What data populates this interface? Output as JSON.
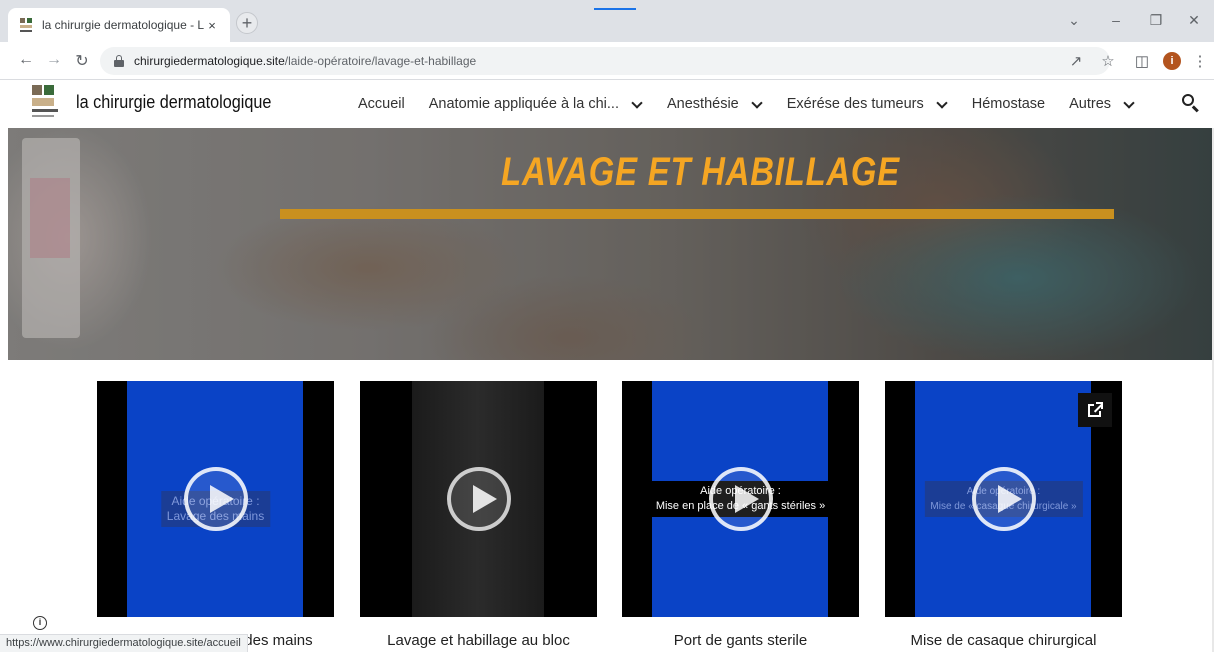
{
  "browser": {
    "tab_title": "la chirurgie dermatologique - La",
    "tab_close": "×",
    "new_tab": "+",
    "url_domain": "chirurgiedermatologique.site",
    "url_path": "/laide-opératoire/lavage-et-habillage",
    "profile_initial": "i",
    "status_url": "https://www.chirurgiedermatologique.site/accueil",
    "icons": {
      "back": "back-arrow-icon",
      "forward": "forward-arrow-icon",
      "reload": "reload-icon",
      "share": "share-icon",
      "bookmark": "star-icon",
      "sidepanel": "side-panel-icon",
      "menu": "kebab-menu-icon"
    }
  },
  "site": {
    "brand": "la chirurgie dermatologique",
    "nav": [
      {
        "label": "Accueil",
        "has_dropdown": false
      },
      {
        "label": "Anatomie appliquée à la chi...",
        "has_dropdown": true
      },
      {
        "label": "Anesthésie",
        "has_dropdown": true
      },
      {
        "label": "Exérése des tumeurs",
        "has_dropdown": true
      },
      {
        "label": "Hémostase",
        "has_dropdown": false
      },
      {
        "label": "Autres",
        "has_dropdown": true
      }
    ]
  },
  "hero": {
    "title": "LAVAGE ET HABILLAGE",
    "title_color": "#f5a623",
    "bar_color": "#c9901f"
  },
  "videos": [
    {
      "caption_line1": "Aide opératoire :",
      "caption_line2": "Lavage des mains",
      "title": "Lavage chirurgical des mains"
    },
    {
      "caption_line1": "",
      "caption_line2": "",
      "title": "Lavage et habillage au bloc"
    },
    {
      "caption_line1": "Aide opératoire :",
      "caption_line2": "Mise en place de « gants stériles »",
      "title": "Port de gants sterile"
    },
    {
      "caption_line1": "Aide opératoire :",
      "caption_line2": "Mise de « casaque chirurgicale »",
      "title": "Mise de casaque chirurgical"
    }
  ],
  "colors": {
    "video_blue": "#0a43c6",
    "chrome_accent": "#1a73e8"
  }
}
